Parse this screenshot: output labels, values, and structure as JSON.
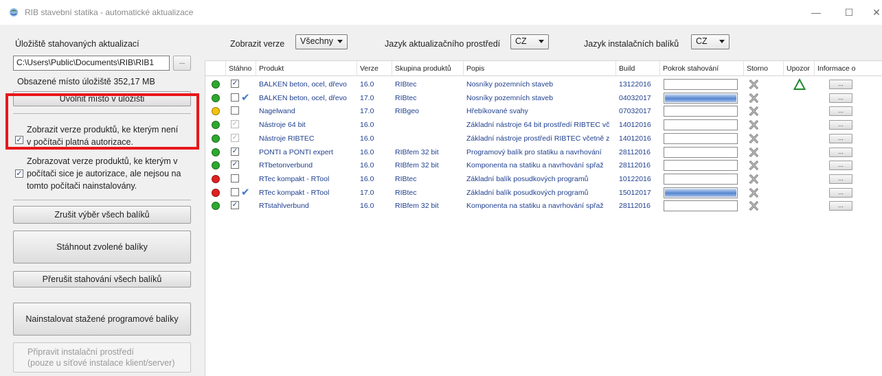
{
  "window": {
    "title": "RIB stavební statika - automatické aktualizace",
    "minimize_glyph": "—",
    "maximize_glyph": "☐",
    "close_glyph": "✕"
  },
  "left_panel": {
    "storage_label": "Úložiště stahovaných aktualizací",
    "storage_path": "C:\\Users\\Public\\Documents\\RIB\\RIB1",
    "browse_label": "...",
    "used_space": "Obsazené místo úložiště 352,17 MB",
    "free_space_button": "Uvolnit místo v úložišti",
    "option1": {
      "line1": "Zobrazit verze produktů, ke kterým není",
      "line2": "v počítači platná autorizace.",
      "checked": true
    },
    "option2": {
      "line1": "Zobrazovat verze produktů, ke kterým v",
      "line2": "počítači sice je autorizace, ale nejsou na",
      "line3": "tomto počítači nainstalovány.",
      "checked": true
    },
    "clear_selection_button": "Zrušit výběr všech balíků",
    "download_button": "Stáhnout zvolené balíky",
    "stop_download_button": "Přerušit stahování všech balíků",
    "install_button": "Nainstalovat stažené programové balíky",
    "prepare_button": {
      "line1": "Připravit instalační prostředí",
      "line2": "(pouze u síťové instalace klient/server)"
    }
  },
  "filters": {
    "show_versions_label": "Zobrazit verze",
    "show_versions_value": "Všechny",
    "update_lang_label": "Jazyk aktualizačního prostředí",
    "update_lang_value": "CZ",
    "package_lang_label": "Jazyk instalačních balíků",
    "package_lang_value": "CZ"
  },
  "grid": {
    "headers": {
      "downloaded": "Stáhno",
      "product": "Produkt",
      "version": "Verze",
      "group": "Skupina produktů",
      "description": "Popis",
      "build": "Build",
      "progress": "Pokrok stahování",
      "cancel": "Storno",
      "warning": "Upozor",
      "info": "Informace o"
    },
    "info_button_label": "...",
    "rows": [
      {
        "status": "#2ea82e",
        "checked": true,
        "dim": false,
        "done": false,
        "product": "BALKEN beton, ocel, dřevo",
        "version": "16.0",
        "group": "RIBtec",
        "description": "Nosníky pozemních staveb",
        "build": "13122016",
        "progress": 0,
        "warning": true
      },
      {
        "status": "#2ea82e",
        "checked": false,
        "dim": false,
        "done": true,
        "product": "BALKEN beton, ocel, dřevo",
        "version": "17.0",
        "group": "RIBtec",
        "description": "Nosníky pozemních staveb",
        "build": "04032017",
        "progress": 1.0,
        "warning": false
      },
      {
        "status": "#f2c40f",
        "checked": false,
        "dim": false,
        "done": false,
        "product": "Nagelwand",
        "version": "17.0",
        "group": "RIBgeo",
        "description": "Hřebíkované svahy",
        "build": "07032017",
        "progress": 0,
        "warning": false
      },
      {
        "status": "#2ea82e",
        "checked": true,
        "dim": true,
        "done": false,
        "product": "Nástroje 64 bit",
        "version": "16.0",
        "group": "",
        "description": "Základní nástroje 64 bit prostředí RIBTEC vč",
        "build": "14012016",
        "progress": 0,
        "warning": false
      },
      {
        "status": "#2ea82e",
        "checked": true,
        "dim": true,
        "done": false,
        "product": "Nástroje RIBTEC",
        "version": "16.0",
        "group": "",
        "description": "Základní nástroje prostředí RIBTEC včetně z",
        "build": "14012016",
        "progress": 0,
        "warning": false
      },
      {
        "status": "#2ea82e",
        "checked": true,
        "dim": false,
        "done": false,
        "product": "PONTI a PONTI expert",
        "version": "16.0",
        "group": "RIBfem 32 bit",
        "description": "Programový balík pro statiku a navrhování",
        "build": "28112016",
        "progress": 0,
        "warning": false
      },
      {
        "status": "#2ea82e",
        "checked": true,
        "dim": false,
        "done": false,
        "product": "RTbetonverbund",
        "version": "16.0",
        "group": "RIBfem 32 bit",
        "description": "Komponenta na statiku a navrhování spřaž",
        "build": "28112016",
        "progress": 0,
        "warning": false
      },
      {
        "status": "#e02020",
        "checked": false,
        "dim": false,
        "done": false,
        "product": "RTec kompakt - RTool",
        "version": "16.0",
        "group": "RIBtec",
        "description": "Základní balík posudkových programů",
        "build": "10122016",
        "progress": 0,
        "warning": false
      },
      {
        "status": "#e02020",
        "checked": false,
        "dim": false,
        "done": true,
        "product": "RTec kompakt - RTool",
        "version": "17.0",
        "group": "RIBtec",
        "description": "Základní balík posudkových programů",
        "build": "15012017",
        "progress": 1.0,
        "warning": false
      },
      {
        "status": "#2ea82e",
        "checked": true,
        "dim": false,
        "done": false,
        "product": "RTstahlverbund",
        "version": "16.0",
        "group": "RIBfem 32 bit",
        "description": "Komponenta na statiku a navrhování spřaž",
        "build": "28112016",
        "progress": 0,
        "warning": false
      }
    ]
  },
  "colors": {
    "highlight": "#e8161a",
    "link_text": "#1f3f8e",
    "progress_fill": "#5586cf"
  },
  "icons": {
    "storno": "close-x-icon",
    "warning": "warning-triangle-icon",
    "done": "checkmark-icon"
  }
}
